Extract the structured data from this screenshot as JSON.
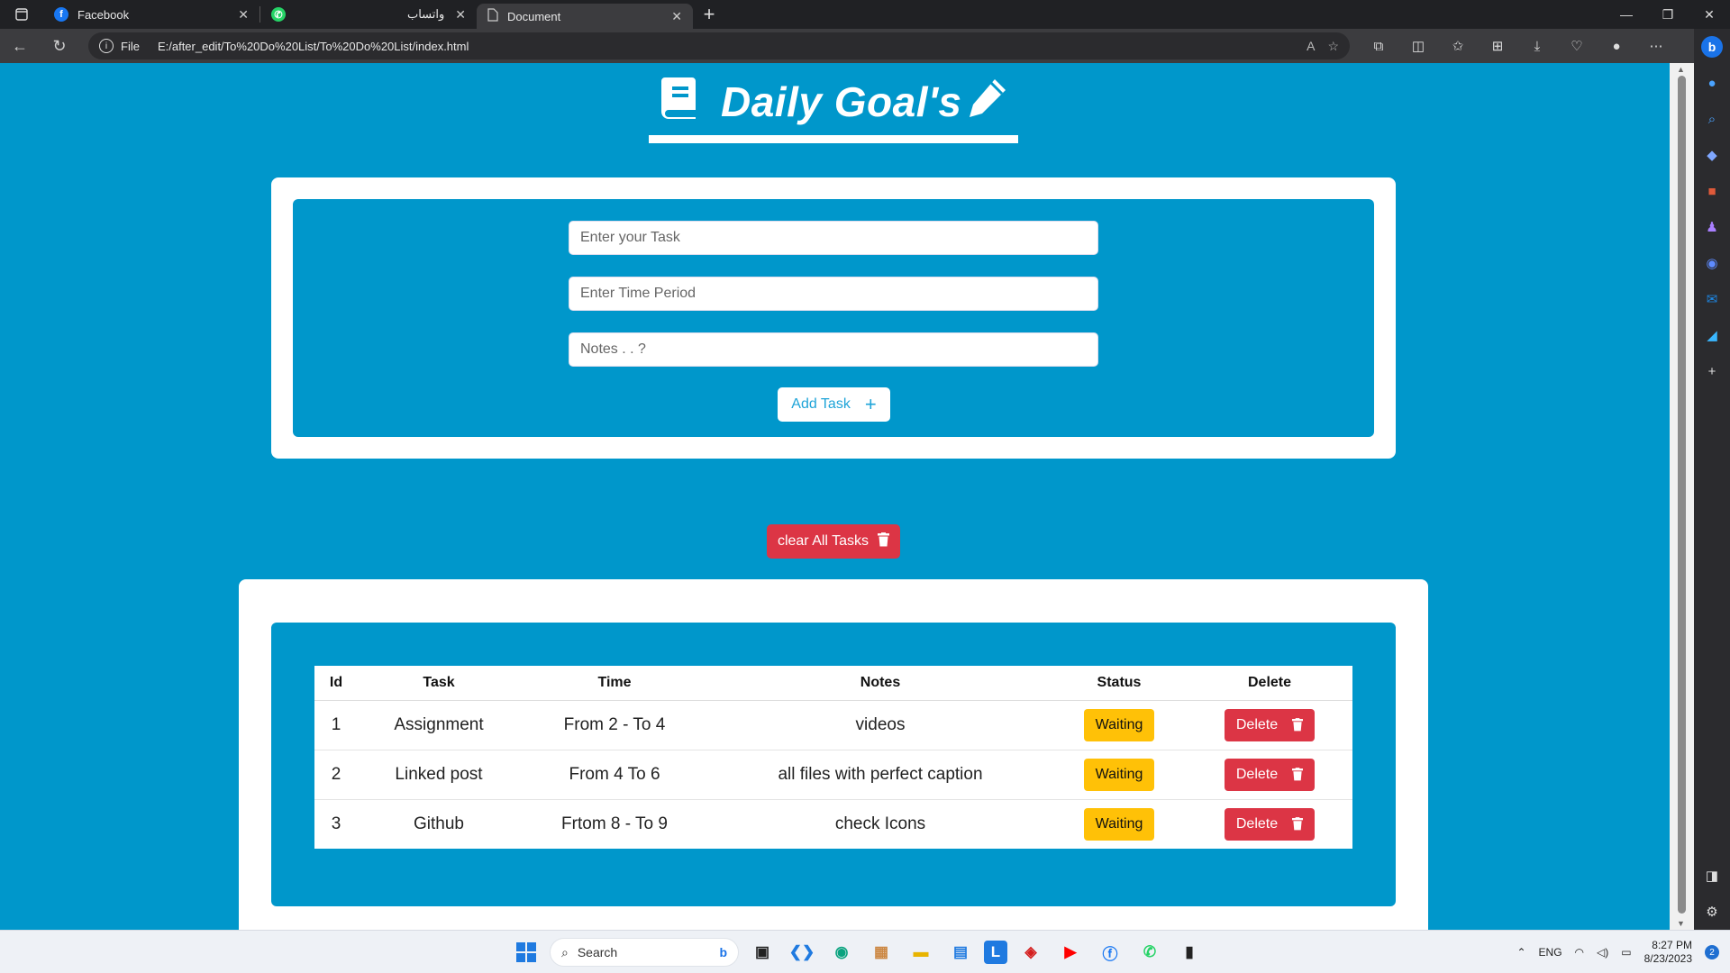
{
  "browser": {
    "tabs": [
      {
        "title": "Facebook",
        "icon": "facebook-icon",
        "color": "#1877f2"
      },
      {
        "title": "واتساب",
        "icon": "whatsapp-icon",
        "color": "#25d366"
      },
      {
        "title": "Document",
        "icon": "document-icon",
        "color": "#cccccc",
        "active": true
      }
    ],
    "url_scheme": "File",
    "url": "E:/after_edit/To%20Do%20List/To%20Do%20List/index.html"
  },
  "header": {
    "title": "Daily Goal's",
    "left_icon": "book-icon",
    "right_icon": "pencil-icon"
  },
  "form": {
    "task_placeholder": "Enter your Task",
    "time_placeholder": "Enter Time Period",
    "notes_placeholder": "Notes . . ?",
    "add_label": "Add Task",
    "add_icon": "plus-icon"
  },
  "clear_button": {
    "label": "clear All Tasks",
    "icon": "trash-icon"
  },
  "table": {
    "columns": [
      "Id",
      "Task",
      "Time",
      "Notes",
      "Status",
      "Delete"
    ],
    "rows": [
      {
        "id": "1",
        "task": "Assignment",
        "time": "From 2 - To 4",
        "notes": "videos",
        "status": "Waiting",
        "delete": "Delete"
      },
      {
        "id": "2",
        "task": "Linked post",
        "time": "From 4 To 6",
        "notes": "all files with perfect caption",
        "status": "Waiting",
        "delete": "Delete"
      },
      {
        "id": "3",
        "task": "Github",
        "time": "Frtom 8 - To 9",
        "notes": "check Icons",
        "status": "Waiting",
        "delete": "Delete"
      }
    ]
  },
  "colors": {
    "page_bg": "#0097cb",
    "danger": "#dc3545",
    "warning": "#ffc107",
    "add_text": "#1ea4d8"
  },
  "taskbar": {
    "search_label": "Search",
    "language": "ENG",
    "time": "8:27 PM",
    "date": "8/23/2023",
    "notifications": "2"
  }
}
